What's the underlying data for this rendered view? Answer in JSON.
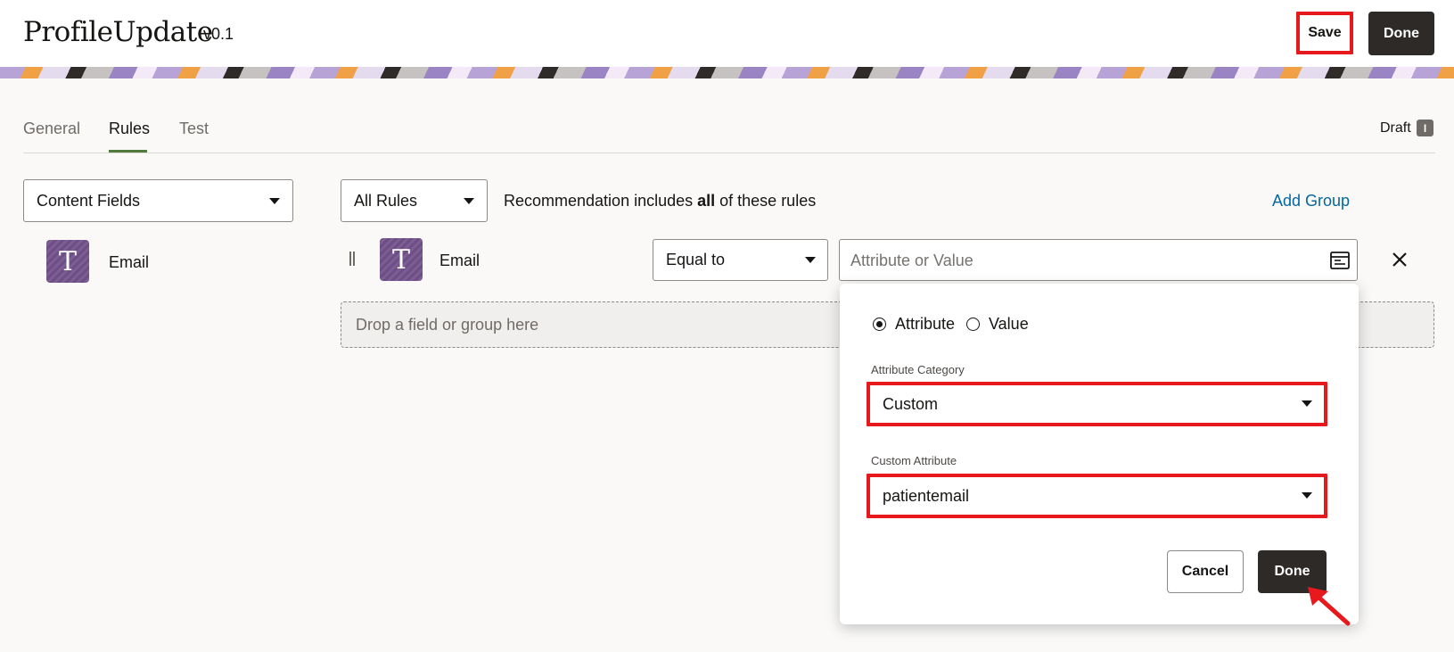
{
  "header": {
    "title": "ProfileUpdate",
    "version": "v0.1",
    "save_label": "Save",
    "done_label": "Done"
  },
  "tabs": [
    {
      "label": "General",
      "active": false
    },
    {
      "label": "Rules",
      "active": true
    },
    {
      "label": "Test",
      "active": false
    }
  ],
  "status": {
    "label": "Draft",
    "badge": "I"
  },
  "left_panel": {
    "select_value": "Content Fields",
    "field": {
      "icon": "text-type-icon",
      "icon_glyph": "T",
      "label": "Email"
    }
  },
  "rules": {
    "match_select": "All Rules",
    "description_prefix": "Recommendation includes ",
    "description_bold": "all",
    "description_suffix": " of these rules",
    "add_group_label": "Add Group",
    "rule_row": {
      "icon_glyph": "T",
      "field_label": "Email",
      "operator": "Equal to",
      "value_placeholder": "Attribute or Value"
    },
    "dropzone_text": "Drop a field or group here"
  },
  "popup": {
    "radio_attribute": "Attribute",
    "radio_value": "Value",
    "selected_radio": "Attribute",
    "category_label": "Attribute Category",
    "category_value": "Custom",
    "custom_label": "Custom Attribute",
    "custom_value": "patientemail",
    "cancel_label": "Cancel",
    "done_label": "Done"
  },
  "colors": {
    "accent_link": "#04679e",
    "annotation_red": "#e8191c",
    "primary_button": "#2d2a28",
    "tab_underline": "#507a3e",
    "field_icon": "#6d4f85"
  }
}
